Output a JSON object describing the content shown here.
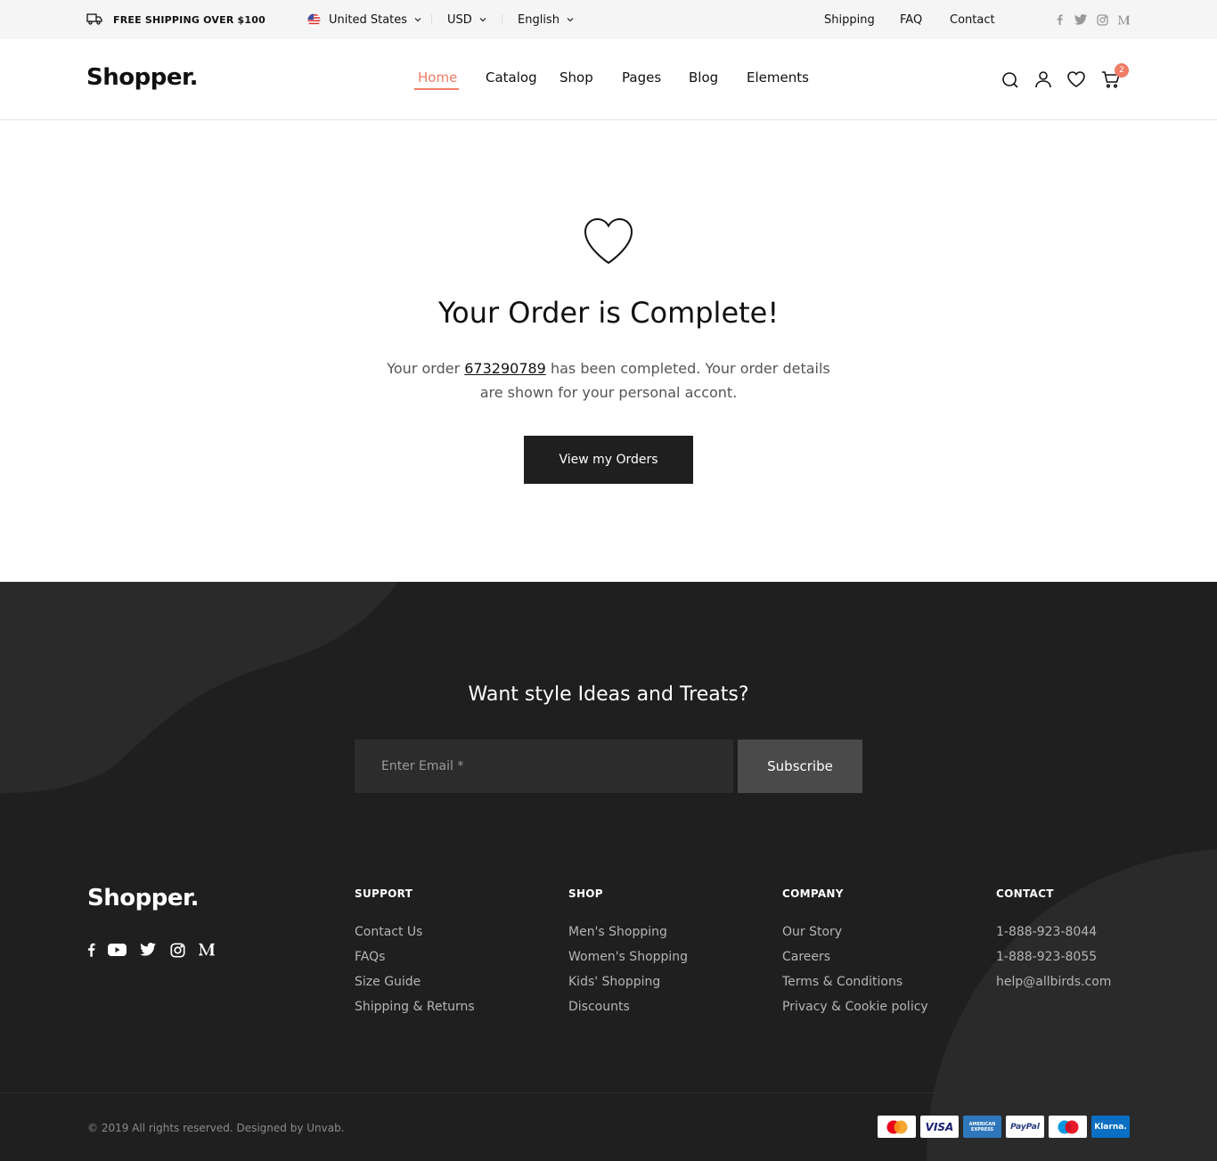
{
  "topbar": {
    "promo": "FREE SHIPPING OVER $100",
    "country": "United States",
    "currency": "USD",
    "language": "English",
    "links": [
      "Shipping",
      "FAQ",
      "Contact"
    ]
  },
  "header": {
    "logo": "Shopper.",
    "nav": [
      "Home",
      "Catalog",
      "Shop",
      "Pages",
      "Blog",
      "Elements"
    ],
    "cart_count": "2"
  },
  "main": {
    "title": "Your Order is Complete!",
    "text_before": "Your order ",
    "order_number": "673290789",
    "text_after": " has been completed. Your order details are shown for your personal accont.",
    "button": "View my Orders"
  },
  "footer": {
    "newsletter_title": "Want style Ideas and Treats?",
    "email_placeholder": "Enter Email *",
    "subscribe": "Subscribe",
    "logo": "Shopper.",
    "columns": [
      {
        "title": "SUPPORT",
        "links": [
          "Contact Us",
          "FAQs",
          "Size Guide",
          "Shipping & Returns"
        ]
      },
      {
        "title": "SHOP",
        "links": [
          "Men's Shopping",
          "Women's Shopping",
          "Kids' Shopping",
          "Discounts"
        ]
      },
      {
        "title": "COMPANY",
        "links": [
          "Our Story",
          "Careers",
          "Terms & Conditions",
          "Privacy & Cookie policy"
        ]
      },
      {
        "title": "CONTACT",
        "links": [
          "1-888-923-8044",
          "1-888-923-8055",
          "help@allbirds.com"
        ]
      }
    ],
    "copyright": "© 2019 All rights reserved. Designed by Unvab.",
    "payments": [
      "Mastercard",
      "VISA",
      "AMERICAN EXPRESS",
      "PayPal",
      "Maestro",
      "Klarna."
    ]
  },
  "colors": {
    "accent": "#f07d66",
    "footer_bg": "#1f1f1f",
    "topbar_bg": "#f5f5f5"
  },
  "icons": [
    "truck-icon",
    "us-flag-icon",
    "facebook-icon",
    "twitter-icon",
    "instagram-icon",
    "medium-icon",
    "search-icon",
    "user-icon",
    "heart-icon",
    "cart-icon",
    "youtube-icon"
  ]
}
